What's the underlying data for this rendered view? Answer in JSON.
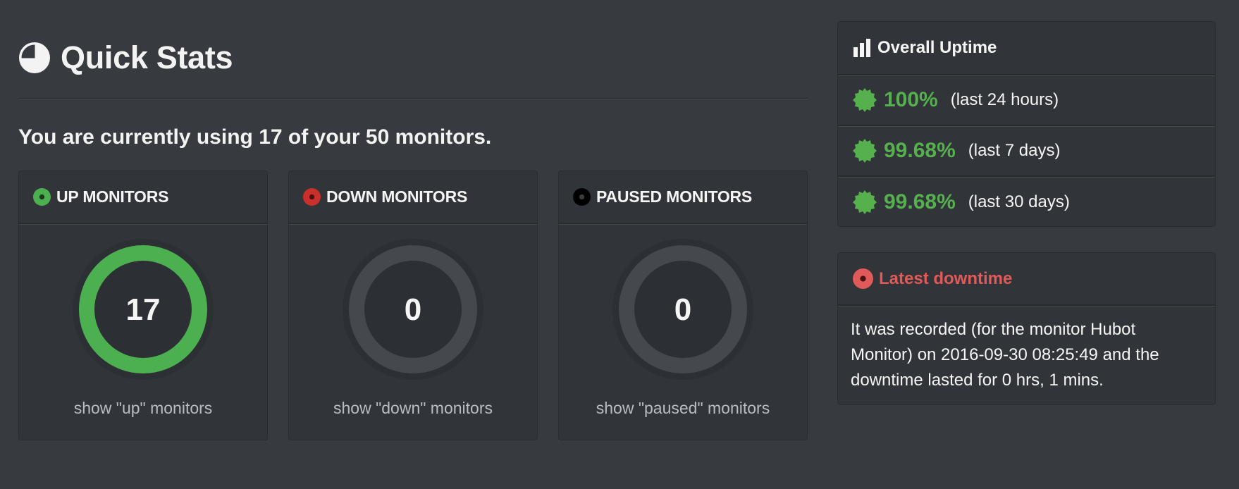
{
  "header": {
    "title": "Quick Stats",
    "icon": "pie-chart-icon"
  },
  "usage": {
    "text": "You are currently using 17 of your 50 monitors."
  },
  "monitors": [
    {
      "title": "UP MONITORS",
      "count": "17",
      "link": "show \"up\" monitors",
      "status_color": "#4caf50",
      "ring_fill": 1.0,
      "icon": "status-up-dot-icon"
    },
    {
      "title": "DOWN MONITORS",
      "count": "0",
      "link": "show \"down\" monitors",
      "status_color": "#c9302c",
      "ring_fill": 0.0,
      "icon": "status-down-dot-icon"
    },
    {
      "title": "PAUSED MONITORS",
      "count": "0",
      "link": "show \"paused\" monitors",
      "status_color": "#000000",
      "ring_fill": 0.0,
      "icon": "status-paused-dot-icon"
    }
  ],
  "uptime": {
    "title": "Overall Uptime",
    "icon": "bar-chart-icon",
    "rows": [
      {
        "value": "100%",
        "period": "(last 24 hours)",
        "icon": "seal-check-icon"
      },
      {
        "value": "99.68%",
        "period": "(last 7 days)",
        "icon": "seal-check-icon"
      },
      {
        "value": "99.68%",
        "period": "(last 30 days)",
        "icon": "seal-check-icon"
      }
    ],
    "accent_color": "#55b04d"
  },
  "downtime": {
    "title": "Latest downtime",
    "icon": "status-down-dot-icon",
    "text": "It was recorded (for the monitor Hubot Monitor) on 2016-09-30 08:25:49 and the downtime lasted for 0 hrs, 1 mins.",
    "accent_color": "#e05a5a"
  }
}
